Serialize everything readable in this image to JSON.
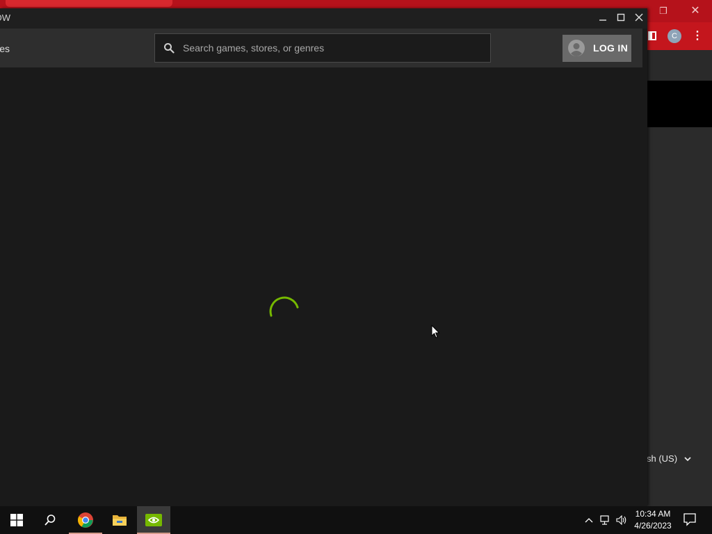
{
  "background_window": {
    "avatar_letter": "C",
    "language_partial": "sh (US)"
  },
  "app_window": {
    "title_partial": "OW",
    "nav_partial": "es",
    "search": {
      "placeholder": "Search games, stores, or genres",
      "value": ""
    },
    "login_label": "LOG IN",
    "accent_color": "#76b900",
    "loading": true
  },
  "taskbar": {
    "apps": [
      "start-menu",
      "search",
      "google-chrome",
      "file-explorer",
      "nvidia-geforce-now"
    ],
    "time": "10:34 AM",
    "date": "4/26/2023"
  }
}
